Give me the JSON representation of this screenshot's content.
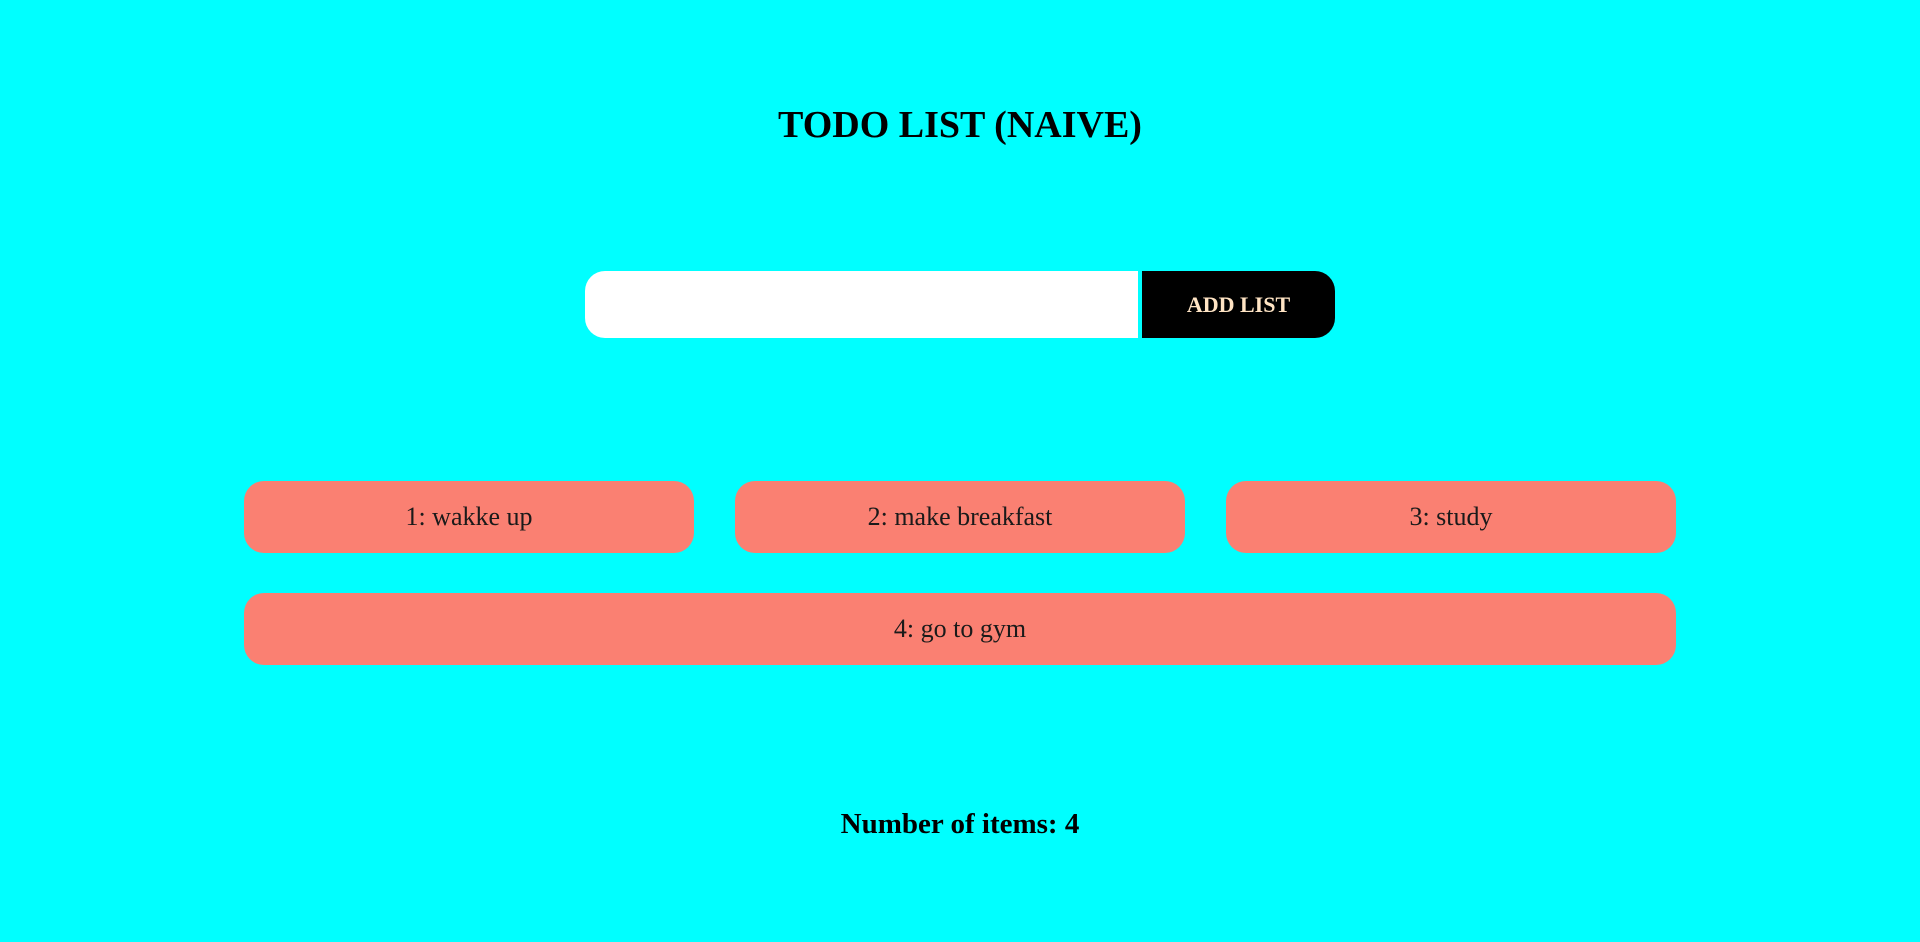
{
  "page": {
    "title": "TODO LIST (NAIVE)",
    "background_color": "#00ffff"
  },
  "form": {
    "input_value": "",
    "input_placeholder": "",
    "add_button_label": "ADD LIST",
    "button_color": "#000000",
    "button_text_color": "#ffe4c4"
  },
  "items": [
    {
      "label": "1: wakke up"
    },
    {
      "label": "2: make breakfast"
    },
    {
      "label": "3: study"
    },
    {
      "label": "4: go to gym"
    }
  ],
  "item_color": "#fa8072",
  "footer": {
    "count_text": "Number of items: 4"
  }
}
